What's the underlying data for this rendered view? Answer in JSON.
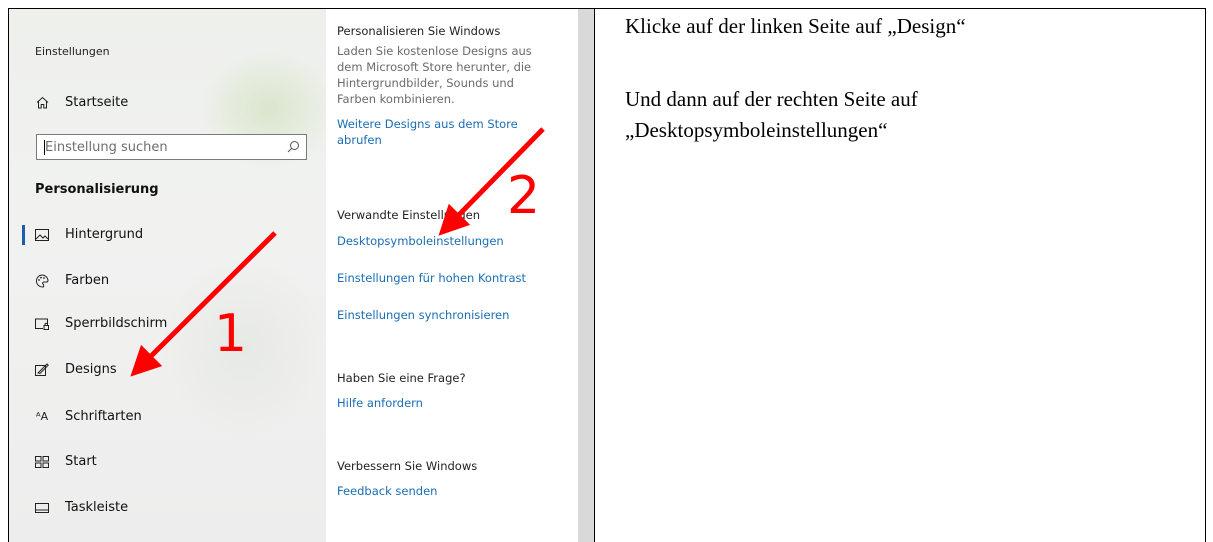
{
  "settings": {
    "app_title": "Einstellungen",
    "home_label": "Startseite",
    "search_placeholder": "Einstellung suchen",
    "section_title": "Personalisierung",
    "nav_items": [
      {
        "label": "Hintergrund",
        "icon": "picture-icon"
      },
      {
        "label": "Farben",
        "icon": "palette-icon"
      },
      {
        "label": "Sperrbildschirm",
        "icon": "lockscreen-icon"
      },
      {
        "label": "Designs",
        "icon": "brush-icon"
      },
      {
        "label": "Schriftarten",
        "icon": "font-icon"
      },
      {
        "label": "Start",
        "icon": "start-icon"
      },
      {
        "label": "Taskleiste",
        "icon": "taskbar-icon"
      }
    ],
    "active_item": "Hintergrund"
  },
  "content": {
    "personalize_heading": "Personalisieren Sie Windows",
    "personalize_text": [
      "Laden Sie kostenlose Designs aus",
      "dem Microsoft Store herunter, die",
      "Hintergrundbilder, Sounds und",
      "Farben kombinieren."
    ],
    "store_link": [
      "Weitere Designs aus dem Store",
      "abrufen"
    ],
    "related_heading": "Verwandte Einstellungen",
    "related_links": [
      "Desktopsymboleinstellungen",
      "Einstellungen für hohen Kontrast",
      "Einstellungen synchronisieren"
    ],
    "question_heading": "Haben Sie eine Frage?",
    "help_link": "Hilfe anfordern",
    "improve_heading": "Verbessern Sie Windows",
    "feedback_link": "Feedback senden"
  },
  "annotations": {
    "marker_1": "1",
    "marker_2": "2",
    "arrow_color": "#ff0000"
  },
  "instructions": {
    "line1": "Klicke auf der linken Seite auf „Design“",
    "line2": "Und dann auf der rechten Seite auf",
    "line3": "„Desktopsymboleinstellungen“"
  }
}
